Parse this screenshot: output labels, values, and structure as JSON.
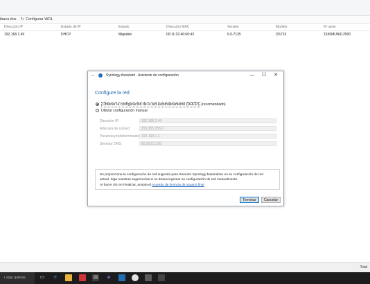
{
  "toolbar": {
    "left_label": "ibaca dos",
    "wol_label": "Configurar WOL"
  },
  "table": {
    "headers": [
      "Dirección IP",
      "Estado de IP",
      "Estado",
      "Dirección MAC",
      "Versión",
      "Modelo",
      "Nº serie"
    ],
    "rows": [
      [
        "192.168.1.49",
        "DHCP",
        "Migrable",
        "00:11:32:46:66:43",
        "6.0-7135",
        "DS715",
        "1530MUN012500"
      ]
    ]
  },
  "statusbar": {
    "right_text": "Total"
  },
  "taskbar": {
    "search_text": "r aquí quieras"
  },
  "dialog": {
    "title": "Synology Assistant - Asistente de configuración",
    "heading": "Configure la red",
    "option_dhcp": "Obtener la configuración de la red automáticamente (DHCP)",
    "option_dhcp_suffix": "(recomendado)",
    "option_manual": "Utilizar configuración manual",
    "fields": {
      "ip_label": "Dirección IP:",
      "ip_value": "192.168.1.49",
      "mask_label": "Máscara de subred:",
      "mask_value": "255.255.255.0",
      "gateway_label": "Pasarela predeterminada:",
      "gateway_value": "192.168.1.1",
      "dns_label": "Servidor DNS:",
      "dns_value": "80.58.61.250"
    },
    "info_line1": "Se proporciona la configuración de red sugerida para Servidor Synology basándose en su configuración de red",
    "info_line2": "actual. Siga nuestras sugerencias si no desea ingresar su configuración de red manualmente.",
    "info_line3_prefix": "Al hacer clic en Finalizar, acepta el ",
    "info_link": "Acuerdo de licencia de usuario final",
    "finish_button": "Terminar",
    "cancel_button": "Cancelar"
  },
  "colors": {
    "accent": "#1f5fa8",
    "taskbar": "#1c1c1c"
  }
}
